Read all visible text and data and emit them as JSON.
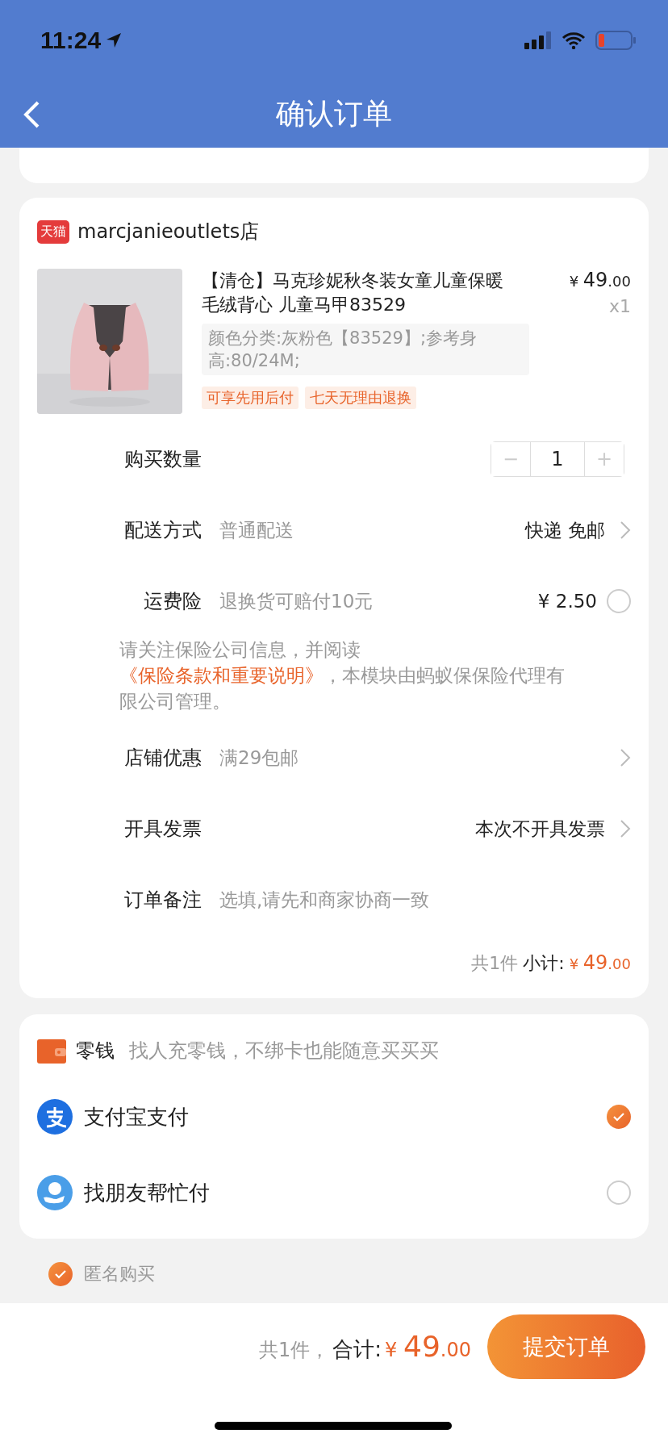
{
  "status_bar": {
    "time": "11:24"
  },
  "nav": {
    "title": "确认订单"
  },
  "shop": {
    "badge": "天猫",
    "name": "marcjanieoutlets店"
  },
  "product": {
    "title": "【清仓】马克珍妮秋冬装女童儿童保暖毛绒背心 儿童马甲83529",
    "currency": "¥",
    "price": "49",
    "decimal": ".00",
    "count": "x1",
    "sku": "颜色分类:灰粉色【83529】;参考身高:80/24M;",
    "tags": [
      "可享先用后付",
      "七天无理由退换"
    ]
  },
  "rows": [
    {
      "kind": "stepper",
      "label": "购买数量",
      "minus": "−",
      "value": "1",
      "plus": "+"
    },
    {
      "kind": "select",
      "label": "配送方式",
      "hint": "普通配送",
      "value": "快递 免邮"
    },
    {
      "kind": "insurance",
      "label": "运费险",
      "hint": "退换货可赔付10元",
      "value": "¥ 2.50",
      "checked": false
    },
    {
      "kind": "notice",
      "before": "请关注保险公司信息，并阅读",
      "link": "《保险条款和重要说明》",
      "after": "，本模块由蚂蚁保保险代理有限公司管理。"
    },
    {
      "kind": "select",
      "label": "店铺优惠",
      "hint": "满29包邮"
    },
    {
      "kind": "select",
      "label": "开具发票",
      "value": "本次不开具发票"
    },
    {
      "kind": "note",
      "label": "订单备注",
      "placeholder": "选填,请先和商家协商一致"
    }
  ],
  "subtotal": {
    "count": "共1件",
    "label": "小计:",
    "currency": "¥",
    "amount": "49",
    "decimal": ".00"
  },
  "payment": {
    "wallet": {
      "label": "零钱",
      "hint": "找人充零钱，不绑卡也能随意买买买"
    },
    "methods": [
      {
        "kind": "alipay",
        "label": "支付宝支付",
        "selected": true
      },
      {
        "kind": "friend",
        "label": "找朋友帮忙付",
        "selected": false
      }
    ]
  },
  "anonymous": {
    "label": "匿名购买",
    "checked": true
  },
  "footer": {
    "count": "共1件，",
    "label": "合计:",
    "currency": "¥",
    "amount": "49",
    "decimal": ".00",
    "submit": "提交订单"
  }
}
